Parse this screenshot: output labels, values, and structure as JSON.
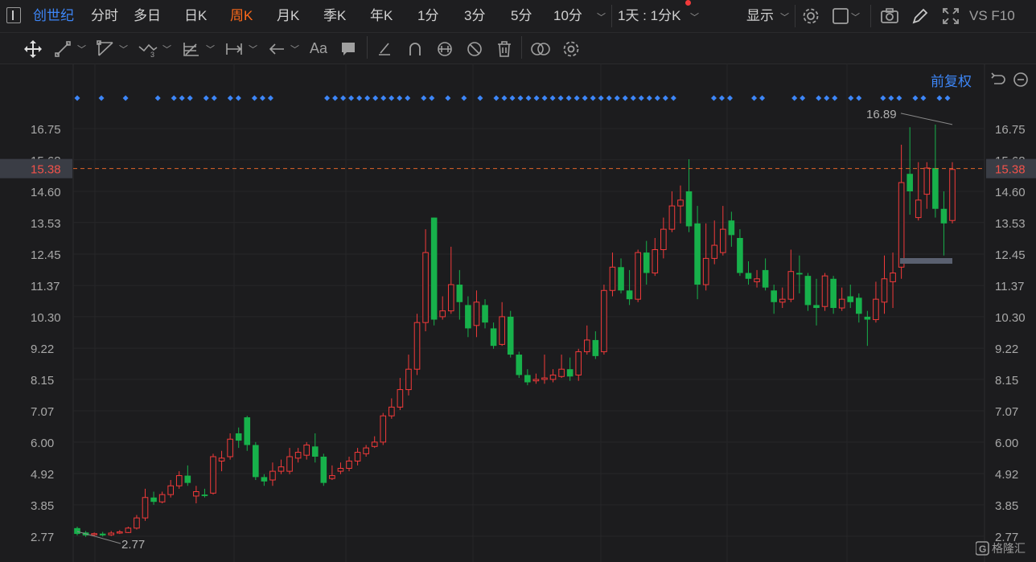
{
  "topbar": {
    "stock_name": "创世纪",
    "periods": [
      "分时",
      "多日",
      "日K",
      "周K",
      "月K",
      "季K",
      "年K",
      "1分",
      "3分",
      "5分",
      "10分"
    ],
    "active_period": "周K",
    "interval": "1天 : 1分K",
    "display_label": "显示",
    "extra_label": "VS F10"
  },
  "toolbar": {
    "tools": [
      "move-tool",
      "line-tool",
      "ray-tool",
      "polyline-tool",
      "fib-tool",
      "measure-tool",
      "arrow-tool",
      "text-tool",
      "comment-tool",
      "eraser-tool",
      "magnet-tool",
      "lock-tool",
      "hide-tool",
      "delete-tool",
      "compare-tool",
      "settings-tool"
    ],
    "text_tool_label": "Aa"
  },
  "chart_header": {
    "adjust_label": "前复权"
  },
  "chart_data": {
    "type": "candlestick",
    "price_axis_ticks": [
      "16.75",
      "15.68",
      "14.60",
      "13.53",
      "12.45",
      "11.37",
      "10.30",
      "9.22",
      "8.15",
      "7.07",
      "6.00",
      "4.92",
      "3.85",
      "2.77"
    ],
    "current_price": "15.38",
    "high_marker": "16.89",
    "low_marker": "2.77",
    "ylim": [
      2.77,
      16.75
    ],
    "colors": {
      "up": "#f23a3a",
      "down": "#17b14b",
      "signal": "#3d86f7"
    },
    "candles": [
      [
        3.05,
        2.85,
        3.1,
        2.8
      ],
      [
        2.9,
        2.8,
        2.95,
        2.75
      ],
      [
        2.82,
        2.86,
        2.9,
        2.78
      ],
      [
        2.86,
        2.8,
        2.92,
        2.76
      ],
      [
        2.82,
        2.88,
        2.95,
        2.78
      ],
      [
        2.88,
        2.92,
        2.98,
        2.85
      ],
      [
        2.9,
        3.05,
        3.1,
        2.88
      ],
      [
        3.05,
        3.4,
        3.5,
        3.0
      ],
      [
        3.4,
        4.1,
        4.4,
        3.3
      ],
      [
        4.1,
        3.95,
        4.3,
        3.85
      ],
      [
        3.95,
        4.2,
        4.3,
        3.9
      ],
      [
        4.2,
        4.5,
        4.7,
        4.1
      ],
      [
        4.5,
        4.85,
        5.0,
        4.4
      ],
      [
        4.85,
        4.6,
        5.2,
        4.5
      ],
      [
        4.15,
        4.3,
        4.5,
        3.9
      ],
      [
        4.2,
        4.15,
        4.4,
        4.1
      ],
      [
        4.25,
        5.5,
        5.6,
        4.2
      ],
      [
        5.35,
        5.45,
        5.7,
        5.0
      ],
      [
        5.5,
        6.1,
        6.3,
        5.4
      ],
      [
        6.3,
        6.05,
        6.5,
        5.8
      ],
      [
        6.85,
        5.9,
        6.9,
        5.7
      ],
      [
        5.9,
        4.8,
        6.0,
        4.7
      ],
      [
        4.8,
        4.65,
        4.9,
        4.5
      ],
      [
        4.7,
        5.0,
        5.3,
        4.5
      ],
      [
        5.0,
        5.15,
        5.4,
        4.9
      ],
      [
        5.0,
        5.5,
        5.8,
        4.9
      ],
      [
        5.45,
        5.65,
        5.8,
        5.3
      ],
      [
        5.55,
        5.9,
        6.0,
        5.4
      ],
      [
        5.85,
        5.5,
        6.3,
        5.3
      ],
      [
        5.5,
        4.6,
        5.6,
        4.5
      ],
      [
        4.75,
        4.85,
        5.2,
        4.7
      ],
      [
        5.0,
        5.1,
        5.3,
        4.9
      ],
      [
        5.1,
        5.35,
        5.5,
        5.0
      ],
      [
        5.35,
        5.65,
        5.8,
        5.2
      ],
      [
        5.6,
        5.8,
        5.9,
        5.5
      ],
      [
        5.85,
        6.0,
        6.2,
        5.8
      ],
      [
        6.0,
        6.9,
        7.0,
        5.9
      ],
      [
        6.9,
        7.2,
        7.5,
        6.8
      ],
      [
        7.2,
        7.8,
        8.2,
        7.1
      ],
      [
        7.8,
        8.5,
        9.0,
        7.6
      ],
      [
        8.5,
        10.1,
        10.4,
        8.3
      ],
      [
        10.1,
        12.5,
        13.3,
        9.8
      ],
      [
        13.7,
        10.2,
        13.7,
        10.0
      ],
      [
        10.3,
        10.5,
        11.0,
        10.2
      ],
      [
        10.5,
        11.4,
        12.7,
        10.4
      ],
      [
        11.4,
        10.8,
        11.9,
        10.2
      ],
      [
        10.7,
        9.9,
        11.0,
        9.6
      ],
      [
        10.0,
        10.8,
        11.2,
        9.6
      ],
      [
        10.7,
        10.1,
        10.9,
        9.9
      ],
      [
        9.9,
        9.3,
        10.1,
        9.2
      ],
      [
        9.35,
        10.3,
        10.8,
        9.3
      ],
      [
        10.3,
        9.0,
        10.5,
        8.9
      ],
      [
        9.0,
        8.3,
        9.1,
        8.2
      ],
      [
        8.3,
        8.05,
        8.5,
        7.95
      ],
      [
        8.1,
        8.15,
        8.35,
        8.0
      ],
      [
        8.15,
        8.2,
        9.0,
        8.0
      ],
      [
        8.15,
        8.3,
        8.5,
        8.05
      ],
      [
        8.25,
        8.5,
        9.0,
        8.2
      ],
      [
        8.5,
        8.25,
        8.9,
        8.1
      ],
      [
        8.3,
        9.1,
        9.2,
        8.1
      ],
      [
        9.1,
        9.5,
        10.0,
        9.0
      ],
      [
        9.5,
        8.95,
        9.8,
        8.85
      ],
      [
        9.1,
        11.2,
        11.4,
        9.0
      ],
      [
        11.2,
        12.0,
        12.5,
        11.0
      ],
      [
        12.0,
        11.2,
        12.3,
        11.1
      ],
      [
        11.2,
        10.9,
        11.9,
        10.7
      ],
      [
        10.9,
        12.5,
        12.6,
        10.8
      ],
      [
        12.5,
        11.8,
        12.9,
        11.4
      ],
      [
        11.8,
        12.6,
        13.0,
        11.7
      ],
      [
        12.6,
        13.3,
        13.7,
        12.3
      ],
      [
        13.3,
        14.1,
        14.6,
        13.2
      ],
      [
        14.1,
        14.3,
        14.8,
        13.5
      ],
      [
        14.6,
        13.4,
        15.7,
        13.2
      ],
      [
        13.5,
        11.4,
        14.1,
        10.9
      ],
      [
        11.4,
        12.3,
        13.5,
        11.2
      ],
      [
        12.3,
        12.75,
        13.6,
        12.1
      ],
      [
        12.5,
        13.3,
        14.1,
        12.4
      ],
      [
        13.6,
        13.1,
        13.9,
        12.7
      ],
      [
        13.0,
        11.8,
        13.3,
        11.7
      ],
      [
        11.8,
        11.6,
        12.2,
        11.4
      ],
      [
        11.5,
        11.6,
        11.9,
        11.3
      ],
      [
        11.9,
        11.3,
        12.3,
        11.2
      ],
      [
        11.2,
        10.8,
        11.4,
        10.4
      ],
      [
        10.8,
        10.9,
        11.3,
        10.6
      ],
      [
        10.9,
        11.85,
        12.6,
        10.8
      ],
      [
        11.8,
        11.75,
        12.4,
        11.1
      ],
      [
        11.7,
        10.7,
        11.8,
        10.5
      ],
      [
        10.7,
        10.6,
        11.6,
        10.0
      ],
      [
        10.65,
        11.7,
        11.8,
        10.5
      ],
      [
        11.6,
        10.6,
        11.7,
        10.4
      ],
      [
        10.6,
        10.9,
        11.3,
        10.5
      ],
      [
        11.0,
        10.8,
        11.4,
        10.6
      ],
      [
        10.95,
        10.4,
        11.1,
        10.1
      ],
      [
        10.3,
        10.2,
        10.5,
        9.3
      ],
      [
        10.2,
        10.9,
        11.5,
        10.1
      ],
      [
        10.8,
        11.6,
        12.4,
        10.4
      ],
      [
        11.5,
        11.8,
        12.5,
        10.6
      ],
      [
        12.0,
        14.9,
        16.2,
        11.6
      ],
      [
        15.2,
        14.6,
        16.8,
        13.8
      ],
      [
        13.7,
        14.3,
        15.6,
        13.6
      ],
      [
        14.5,
        15.4,
        15.6,
        14.0
      ],
      [
        15.4,
        14.0,
        16.89,
        13.7
      ],
      [
        14.0,
        13.5,
        14.6,
        12.4
      ],
      [
        13.6,
        15.35,
        15.6,
        13.5
      ]
    ],
    "signal_count": 106
  }
}
